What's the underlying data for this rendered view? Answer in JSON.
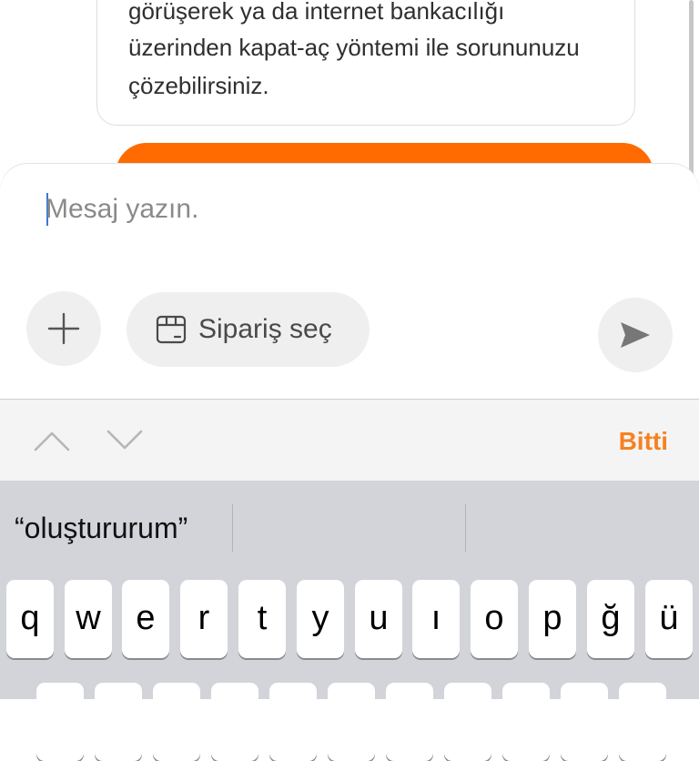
{
  "chat": {
    "message_lines": [
      "görüşerek ya da internet bankacılığı",
      "üzerinden kapat-aç yöntemi ile sorununuzu",
      "çözebilirsiniz."
    ]
  },
  "composer": {
    "placeholder": "Mesaj yazın.",
    "order_button_label": "Sipariş seç"
  },
  "toolbar": {
    "done_label": "Bitti"
  },
  "keyboard": {
    "suggestion": "“oluştururum”",
    "row1": [
      "q",
      "w",
      "e",
      "r",
      "t",
      "y",
      "u",
      "ı",
      "o",
      "p",
      "ğ",
      "ü"
    ]
  },
  "colors": {
    "accent": "#ff6b00",
    "done": "#f5821f",
    "keyboard_bg": "#d2d4da"
  }
}
